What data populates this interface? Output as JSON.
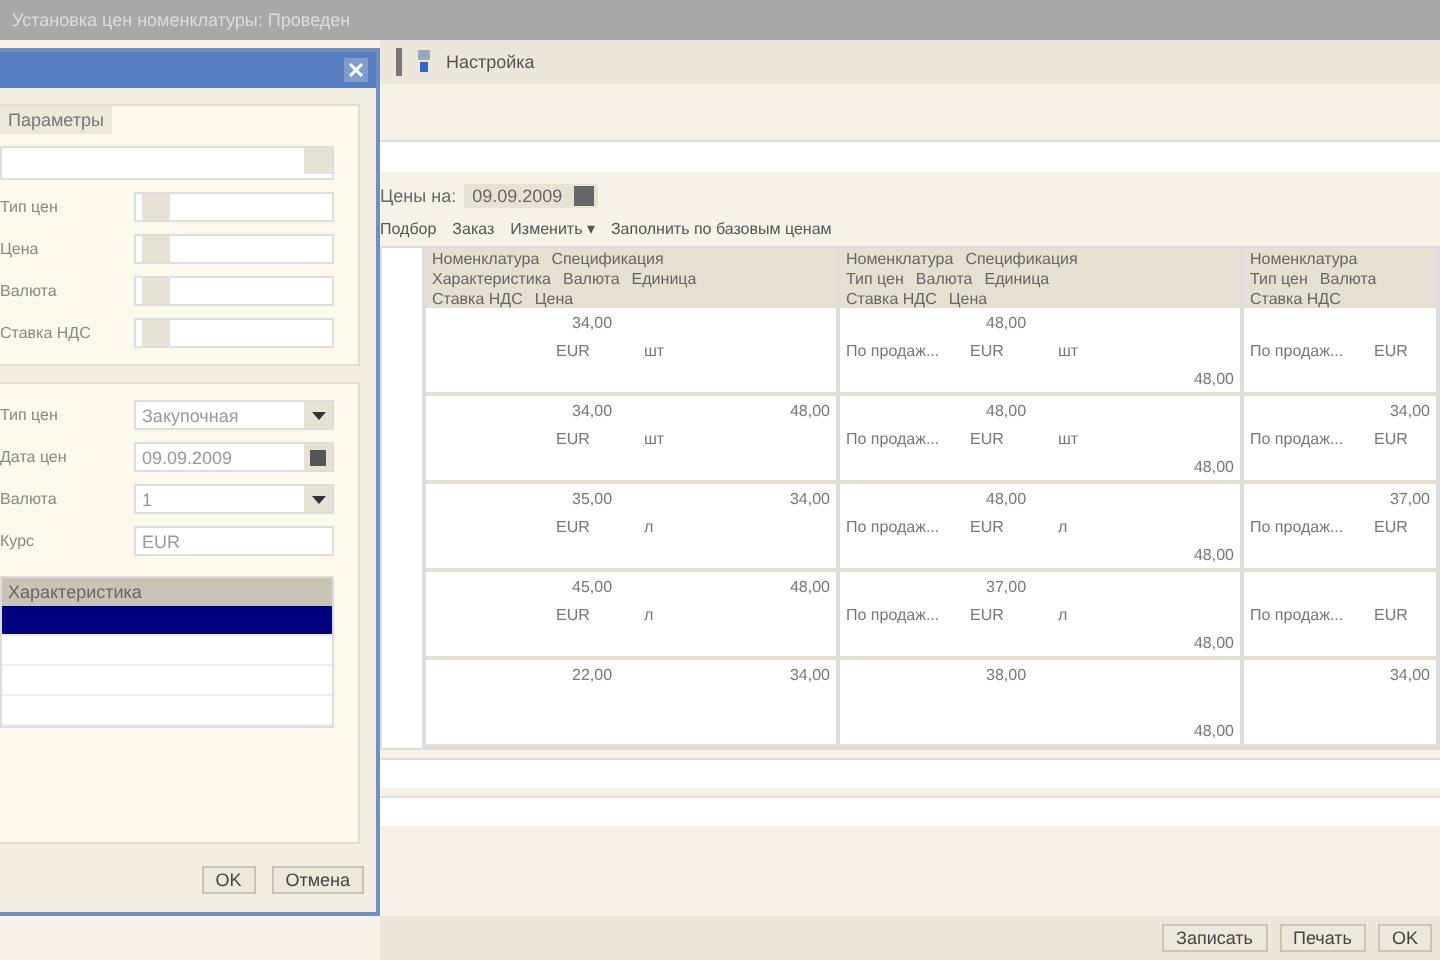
{
  "window": {
    "title": "Установка цен номенклатуры: Проведен"
  },
  "toolbar": {
    "settings_label": "Настройка"
  },
  "main": {
    "date_label": "Цены на:",
    "date_value": "09.09.2009",
    "actions": [
      "Подбор",
      "Заказ",
      "Изменить ▾",
      "Заполнить по базовым ценам"
    ],
    "table": {
      "groups": [
        {
          "header": [
            "Номенклатура",
            "Спецификация"
          ],
          "sub": [
            "Характеристика",
            "Валюта",
            "Единица"
          ],
          "sub2": [
            "Ставка НДС",
            "Цена"
          ]
        },
        {
          "header": [
            "Номенклатура",
            "Спецификация"
          ],
          "sub": [
            "Тип цен",
            "Валюта",
            "Единица"
          ],
          "sub2": [
            "Ставка НДС",
            "Цена"
          ]
        },
        {
          "header": [
            "Номенклатура"
          ],
          "sub": [
            "Тип цен",
            "Валюта"
          ],
          "sub2": [
            "Ставка НДС"
          ]
        }
      ],
      "rows": [
        {
          "cells": [
            {
              "a": "34,00",
              "cur": "EUR",
              "unit": "шт"
            },
            {
              "a": "48,00",
              "type": "По продаж...",
              "cur": "EUR",
              "unit": "шт",
              "sum": "48,00"
            },
            {
              "type": "По продаж...",
              "cur": "EUR"
            }
          ]
        },
        {
          "cells": [
            {
              "a": "34,00",
              "b": "48,00",
              "cur": "EUR",
              "unit": "шт"
            },
            {
              "a": "48,00",
              "type": "По продаж...",
              "cur": "EUR",
              "unit": "шт",
              "sum": "48,00"
            },
            {
              "b": "34,00",
              "type": "По продаж...",
              "cur": "EUR"
            }
          ]
        },
        {
          "cells": [
            {
              "a": "35,00",
              "b": "34,00",
              "cur": "EUR",
              "unit": "л"
            },
            {
              "a": "48,00",
              "type": "По продаж...",
              "cur": "EUR",
              "unit": "л",
              "sum": "48,00"
            },
            {
              "b": "37,00",
              "type": "По продаж...",
              "cur": "EUR"
            }
          ]
        },
        {
          "cells": [
            {
              "a": "45,00",
              "b": "48,00",
              "cur": "EUR",
              "unit": "л"
            },
            {
              "a": "37,00",
              "type": "По продаж...",
              "cur": "EUR",
              "unit": "л",
              "sum": "48,00"
            },
            {
              "type": "По продаж...",
              "cur": "EUR"
            }
          ]
        },
        {
          "cells": [
            {
              "a": "22,00",
              "b": "34,00"
            },
            {
              "a": "38,00",
              "sum": "48,00"
            },
            {
              "b": "34,00"
            }
          ]
        }
      ]
    },
    "buttons": [
      "Записать",
      "Печать",
      "OK"
    ]
  },
  "dialog": {
    "group_title": "Параметры",
    "fields": [
      {
        "label": "Тип цен"
      },
      {
        "label": "Цена"
      },
      {
        "label": "Валюта"
      },
      {
        "label": "Ставка НДС"
      }
    ],
    "lower_fields": [
      {
        "label": "Тип цен",
        "value": "Закупочная",
        "kind": "combo"
      },
      {
        "label": "Дата цен",
        "value": "09.09.2009",
        "kind": "date"
      },
      {
        "label": "Валюта",
        "value": "1",
        "kind": "combo"
      },
      {
        "label": "Курс",
        "value": "EUR",
        "kind": "plain"
      }
    ],
    "list_header": "Характеристика",
    "list_rows": [
      {
        "selected": true
      },
      {
        "selected": false
      },
      {
        "selected": false
      },
      {
        "selected": false
      }
    ],
    "buttons": [
      "OK",
      "Отмена"
    ]
  }
}
